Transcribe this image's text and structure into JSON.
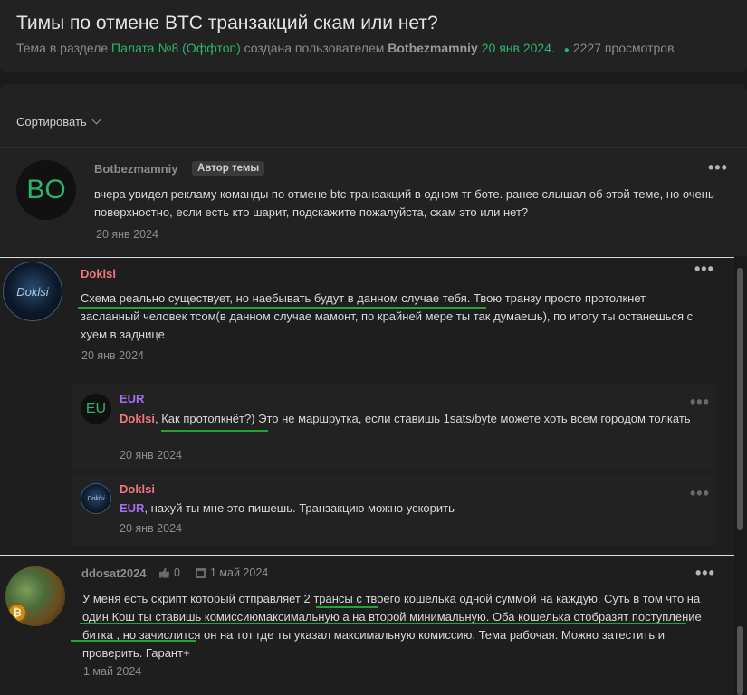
{
  "thread": {
    "title": "Тимы по отмене BTC транзакций скам или нет?",
    "meta_prefix": "Тема в разделе",
    "section": "Палата №8 (Оффтоп)",
    "meta_mid": "создана пользователем",
    "author": "Botbezmamniy",
    "date": "20 янв 2024",
    "views": "2227 просмотров"
  },
  "sort_label": "Сортировать",
  "posts": [
    {
      "avatar_text": "BO",
      "username": "Botbezmamniy",
      "badge": "Автор темы",
      "text": "вчера увидел рекламу команды по отмене btc транзакций в одном тг боте. ранее слышал об этой теме, но очень поверхностно, если есть кто шарит, подскажите пожалуйста, скам это или нет?",
      "date": "20 янв 2024"
    },
    {
      "avatar_text": "Doklsi",
      "username": "Doklsi",
      "text": "Схема реально существует, но наебывать будут в данном случае тебя. Твою транзу просто протолкнет засланный человек тсом(в данном случае мамонт, по крайней мере ты так думаешь), по итогу ты останешься с хуем в заднице",
      "date": "20 янв 2024",
      "replies": [
        {
          "avatar_text": "EU",
          "username": "EUR",
          "mention": "Doklsi",
          "text": ", Как протолкнёт?) Это не маршрутка, если ставишь 1sats/byte можете хоть всем городом толкать",
          "date": "20 янв 2024"
        },
        {
          "avatar_text": "Doklsi",
          "username": "Doklsi",
          "mention": "EUR",
          "text": ", нахуй ты мне это пишешь. Транзакцию можно ускорить",
          "date": "20 янв 2024"
        }
      ]
    },
    {
      "username": "ddosat2024",
      "likes": "0",
      "joined": "1 май 2024",
      "avatar_coin": "₿",
      "text": "У меня есть скрипт который отправляет 2 трансы с твоего кошелька одной суммой на каждую. Суть в том что на один Кош ты ставишь комиссиюмаксимальную а на второй минимальную. Оба кошелька отобразят поступление битка , но зачислится он на тот где ты указал максимальную комиссию. Тема рабочая. Можно затестить и проверить. Гарант+",
      "date": "1 май 2024"
    }
  ],
  "more_icon": "•••",
  "colors": {
    "accent_green": "#2fb26d",
    "mention_pink": "#f2767f",
    "mention_purple": "#a56ff0",
    "underline_green": "#23a23a"
  }
}
